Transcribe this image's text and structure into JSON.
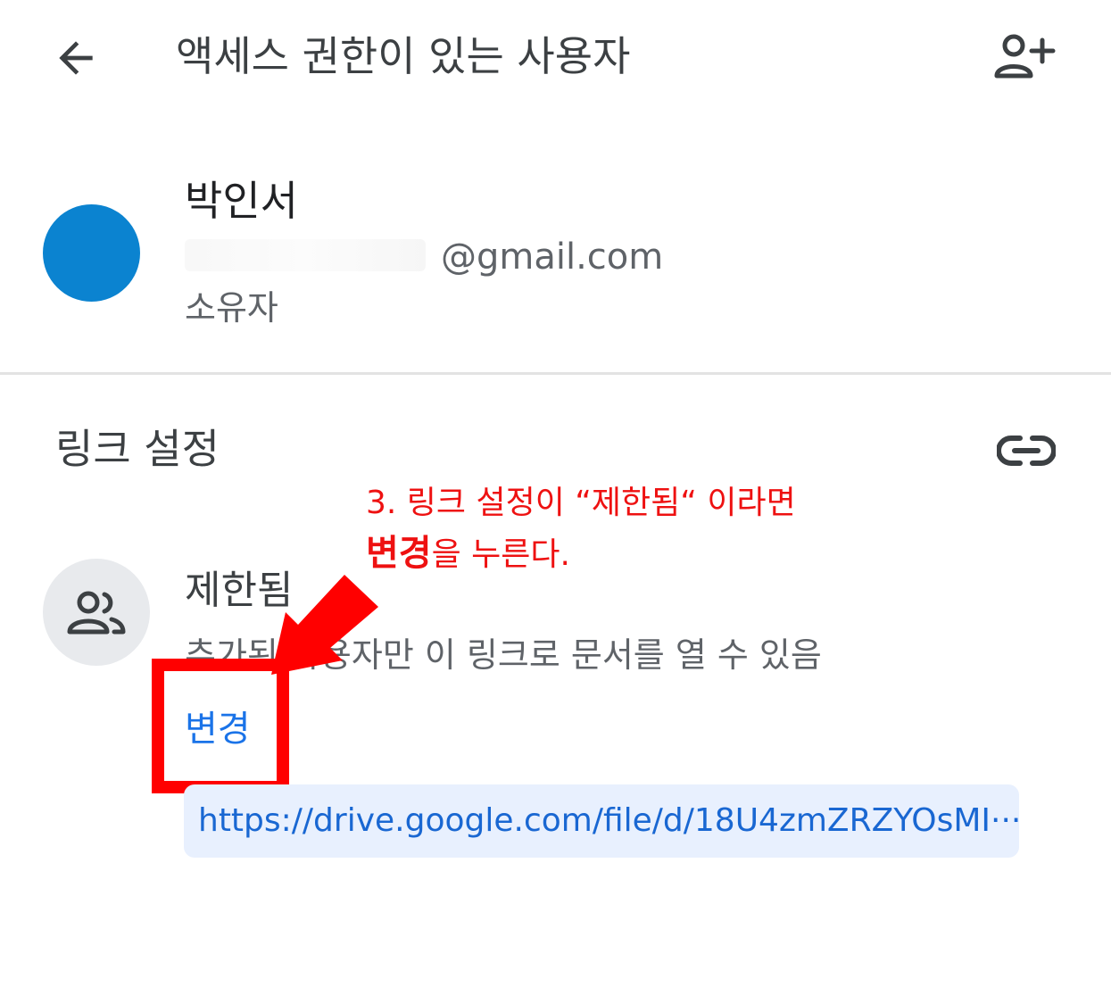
{
  "header": {
    "title": "액세스 권한이 있는 사용자",
    "back_icon": "arrow-left-icon",
    "add_person_icon": "person-add-icon"
  },
  "owner": {
    "name": "박인서",
    "email": "@gmail.com",
    "role": "소유자",
    "avatar_color": "#0b83d0"
  },
  "link_settings": {
    "title": "링크 설정",
    "link_icon": "link-icon",
    "access_icon": "people-icon",
    "access_level": "제한됨",
    "access_description": "추가된 사용자만 이 링크로 문서를 열 수 있음",
    "change_label": "변경",
    "url": "https://drive.google.com/file/d/18U4zmZRZYOsMI···"
  },
  "annotation": {
    "line1": "3. 링크 설정이 “제한됨“ 이라면",
    "line2_bold": "변경",
    "line2_rest": "을 누른다.",
    "color": "#ee1111"
  },
  "colors": {
    "accent": "#1a73e8",
    "highlight": "#ff0000",
    "chip_bg": "#e8f0fe"
  }
}
